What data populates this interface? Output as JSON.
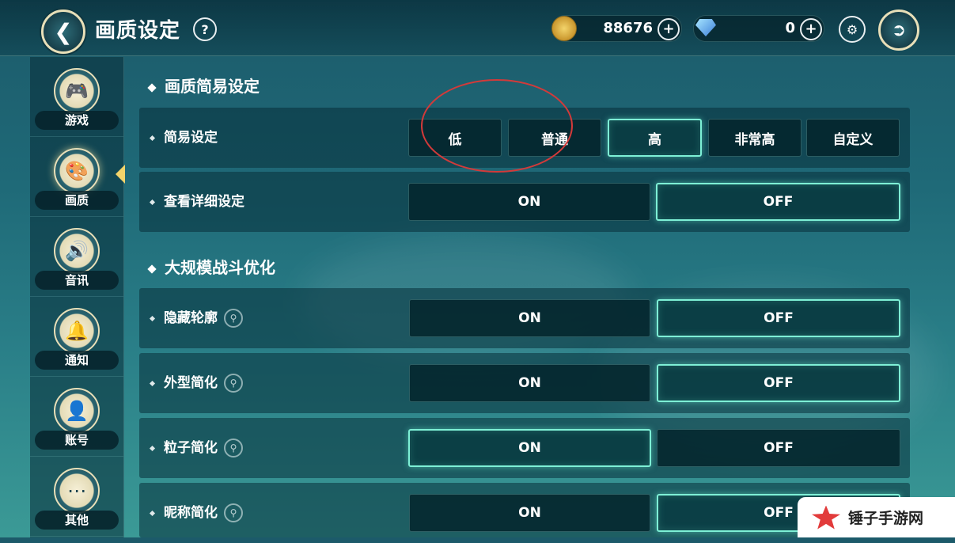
{
  "header": {
    "back_icon": "chevron-left-icon",
    "title": "画质设定",
    "help": "?",
    "gold": "88676",
    "diamond": "0",
    "plus": "+"
  },
  "sidebar": {
    "items": [
      {
        "label": "游戏",
        "icon": "gamepad-icon",
        "glyph": "🎮"
      },
      {
        "label": "画质",
        "icon": "palette-icon",
        "glyph": "🎨"
      },
      {
        "label": "音讯",
        "icon": "speaker-icon",
        "glyph": "🔊"
      },
      {
        "label": "通知",
        "icon": "bell-icon",
        "glyph": "🔔"
      },
      {
        "label": "账号",
        "icon": "user-icon",
        "glyph": "👤"
      },
      {
        "label": "其他",
        "icon": "more-icon",
        "glyph": "⋯"
      }
    ],
    "active": "画质"
  },
  "sections": {
    "quality_title": "画质简易设定",
    "battle_title": "大规模战斗优化"
  },
  "rows": {
    "simple": {
      "label": "简易设定",
      "options": [
        "低",
        "普通",
        "高",
        "非常高",
        "自定义"
      ],
      "selected": "高"
    },
    "detail": {
      "label": "查看详细设定",
      "on": "ON",
      "off": "OFF",
      "selected": "OFF"
    },
    "outline": {
      "label": "隐藏轮廓",
      "on": "ON",
      "off": "OFF",
      "selected": "OFF"
    },
    "appearance": {
      "label": "外型简化",
      "on": "ON",
      "off": "OFF",
      "selected": "OFF"
    },
    "particle": {
      "label": "粒子简化",
      "on": "ON",
      "off": "OFF",
      "selected": "ON"
    },
    "nickname": {
      "label": "昵称简化",
      "on": "ON",
      "off": "OFF",
      "selected": "OFF"
    }
  },
  "watermark": {
    "text": "锤子手游网"
  },
  "colors": {
    "accent": "#7ef0d6",
    "annotation": "#d23a3a"
  }
}
